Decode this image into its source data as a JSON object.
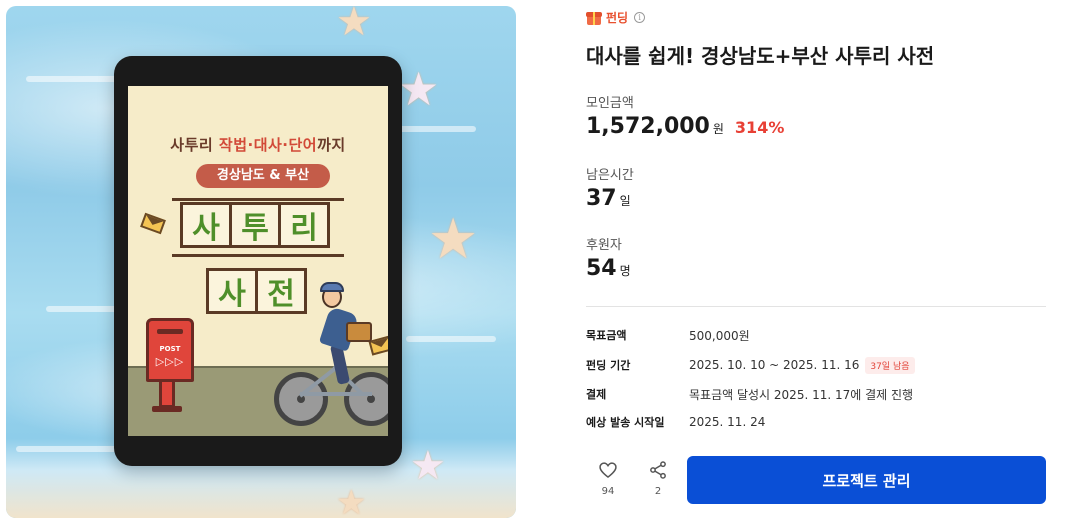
{
  "cover": {
    "subtitle_prefix": "사투리 ",
    "subtitle_highlight": "작법·대사·단어",
    "subtitle_suffix": "까지",
    "region_pill": "경상남도 & 부산",
    "title_row1": [
      "사",
      "투",
      "리"
    ],
    "title_row2": [
      "사",
      "전"
    ],
    "postbox_label": "POST",
    "postbox_arrows": "▷▷▷"
  },
  "badge": {
    "label": "펀딩",
    "icon": "gift-icon",
    "info_icon": "info-icon",
    "color": "#e8502e"
  },
  "project": {
    "title": "대사를 쉽게! 경상남도+부산 사투리 사전"
  },
  "stats": {
    "raised_label": "모인금액",
    "raised_value": "1,572,000",
    "raised_unit": "원",
    "raised_percent": "314%",
    "time_label": "남은시간",
    "time_value": "37",
    "time_unit": "일",
    "backers_label": "후원자",
    "backers_value": "54",
    "backers_unit": "명"
  },
  "details": {
    "goal_key": "목표금액",
    "goal_val": "500,000원",
    "period_key": "펀딩 기간",
    "period_val": "2025. 10. 10 ~ 2025. 11. 16",
    "period_tag": "37일 남음",
    "payment_key": "결제",
    "payment_val": "목표금액 달성시 2025. 11. 17에 결제 진행",
    "ship_key": "예상 발송 시작일",
    "ship_val": "2025. 11. 24"
  },
  "actions": {
    "like_count": "94",
    "share_count": "2",
    "manage_label": "프로젝트 관리"
  },
  "colors": {
    "accent": "#0a4fd6",
    "percent": "#e84035",
    "tag_bg": "#fdeceb"
  }
}
